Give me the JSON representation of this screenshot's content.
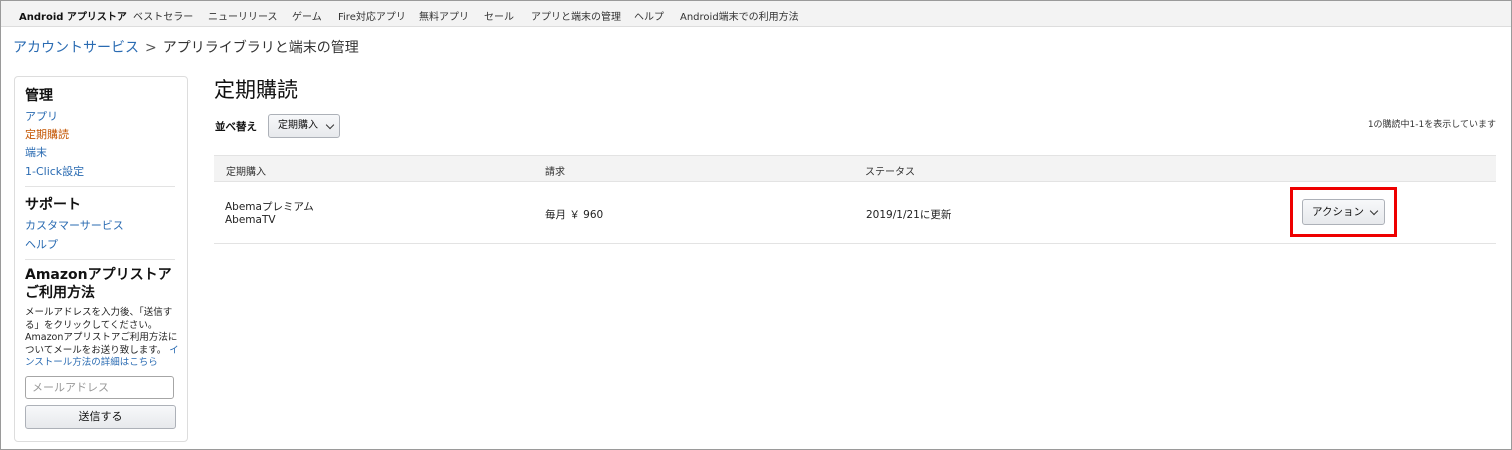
{
  "topnav": {
    "items": [
      {
        "label": "Android アプリストア"
      },
      {
        "label": "ベストセラー"
      },
      {
        "label": "ニューリリース"
      },
      {
        "label": "ゲーム"
      },
      {
        "label": "Fire対応アプリ"
      },
      {
        "label": "無料アプリ"
      },
      {
        "label": "セール"
      },
      {
        "label": "アプリと端末の管理"
      },
      {
        "label": "ヘルプ"
      },
      {
        "label": "Android端末での利用方法"
      }
    ]
  },
  "breadcrumb": {
    "parent": "アカウントサービス",
    "separator": ">",
    "current": "アプリライブラリと端末の管理"
  },
  "sidebar": {
    "manage_heading": "管理",
    "manage_links": [
      {
        "label": "アプリ"
      },
      {
        "label": "定期購読"
      },
      {
        "label": "端末"
      },
      {
        "label": "1-Click設定"
      }
    ],
    "support_heading": "サポート",
    "support_links": [
      {
        "label": "カスタマーサービス"
      },
      {
        "label": "ヘルプ"
      }
    ],
    "howto_heading_line1": "Amazonアプリストア",
    "howto_heading_line2": "ご利用方法",
    "howto_text": "メールアドレスを入力後、「送信する」をクリックしてください。Amazonアプリストアご利用方法についてメールをお送り致します。",
    "howto_link": "インストール方法の詳細はこちら",
    "email_placeholder": "メールアドレス",
    "send_label": "送信する"
  },
  "main": {
    "title": "定期購読",
    "sort_label": "並べ替え",
    "sort_value": "定期購入",
    "count_text": "1の購読中1-1を表示しています",
    "columns": [
      "定期購入",
      "請求",
      "ステータス"
    ],
    "rows": [
      {
        "name": "Abemaプレミアム",
        "publisher": "AbemaTV",
        "billing": "毎月 ￥ 960",
        "status": "2019/1/21に更新",
        "action": "アクション"
      }
    ]
  },
  "colors": {
    "link": "#2a6bb2",
    "active_link": "#c45500",
    "highlight": "#ee0000"
  }
}
